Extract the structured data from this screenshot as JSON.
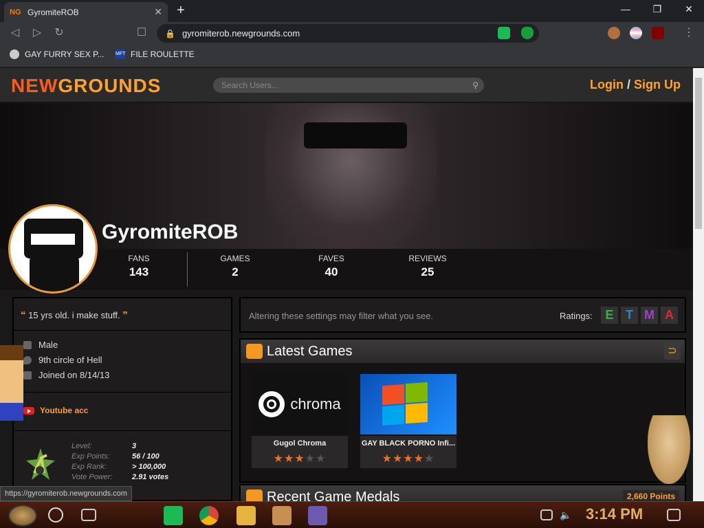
{
  "browser": {
    "tab_title": "GyromiteROB",
    "tab_favicon": "NG",
    "url": "gyromiterob.newgrounds.com",
    "bookmarks": [
      {
        "label": "GAY FURRY SEX P..."
      },
      {
        "label": "FILE ROULETTE",
        "icon_text": "MFT"
      }
    ],
    "status_url": "https://gyromiterob.newgrounds.com"
  },
  "site": {
    "logo_new": "NEW",
    "logo_grounds": "GROUNDS",
    "search_placeholder": "Search Users...",
    "login": "Login",
    "login_sep": " / ",
    "signup": "Sign Up"
  },
  "profile": {
    "username": "GyromiteROB",
    "stats": [
      {
        "label": "FANS",
        "value": "143"
      },
      {
        "label": "GAMES",
        "value": "2"
      },
      {
        "label": "FAVES",
        "value": "40"
      },
      {
        "label": "REVIEWS",
        "value": "25"
      }
    ],
    "quote": "15 yrs old. i make stuff.",
    "gender": "Male",
    "location": "9th circle of Hell",
    "joined": "Joined on 8/14/13",
    "youtube_link": "Youtube acc",
    "level": {
      "labels": [
        "Level:",
        "Exp Points:",
        "Exp Rank:",
        "Vote Power:"
      ],
      "values": [
        "3",
        "56 / 100",
        "> 100,000",
        "2.91 votes"
      ]
    }
  },
  "filter": {
    "text": "Altering these settings may filter what you see.",
    "ratings_label": "Ratings:",
    "ratings": [
      {
        "letter": "E",
        "color": "#3cb043"
      },
      {
        "letter": "T",
        "color": "#2a86c8"
      },
      {
        "letter": "M",
        "color": "#a040c8"
      },
      {
        "letter": "A",
        "color": "#e02a2a"
      }
    ]
  },
  "latest_games": {
    "title": "Latest Games",
    "games": [
      {
        "title": "Gugol Chroma",
        "stars": 3,
        "thumb_text": "chroma"
      },
      {
        "title": "GAY BLACK PORNO Infi...",
        "stars": 4
      }
    ]
  },
  "medals": {
    "title": "Recent Game Medals",
    "points": "2,660 Points"
  },
  "taskbar": {
    "clock": "3:14 PM"
  },
  "colors": {
    "accent": "#ffa030",
    "brand_red": "#ff5a1e"
  }
}
